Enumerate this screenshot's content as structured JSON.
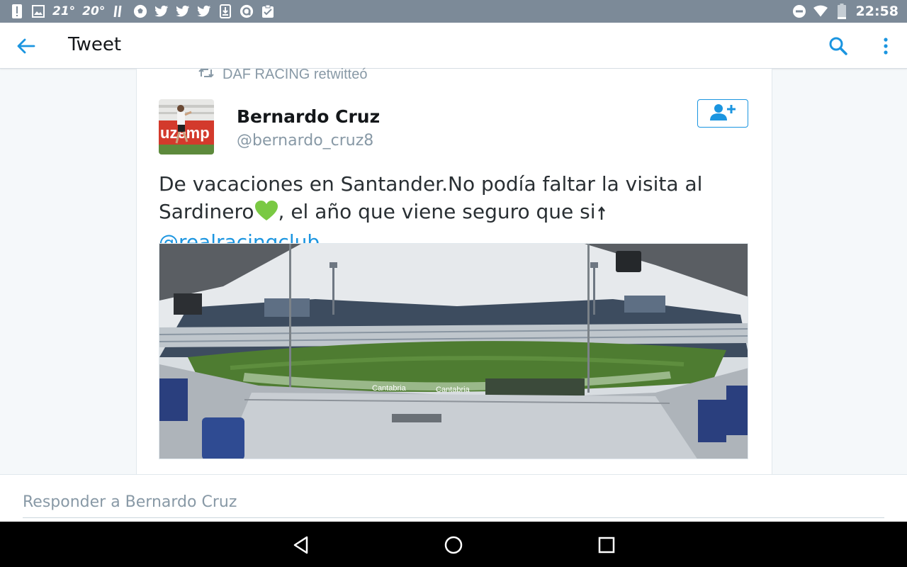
{
  "status_bar": {
    "temp1": "21°",
    "temp2": "20°",
    "time": "22:58",
    "battery_level": 0.15,
    "left_icons": [
      "alert-icon",
      "image-icon",
      "weather-icon",
      "soccer-icon",
      "twitter-icon",
      "twitter-icon",
      "twitter-icon",
      "download-icon",
      "app-icon",
      "clipboard-icon"
    ],
    "right_icons": [
      "do-not-disturb-icon",
      "wifi-icon",
      "battery-icon"
    ]
  },
  "app_bar": {
    "title": "Tweet",
    "icons": [
      "back-arrow-icon",
      "search-icon",
      "more-vert-icon"
    ]
  },
  "tweet": {
    "retweet_label": "DAF RACING retwitteó",
    "author_name": "Bernardo Cruz",
    "author_handle": "@bernardo_cruz8",
    "text_part1": "De vacaciones en Santander.No podía faltar la visita al Sardinero",
    "text_part2": ", el año que viene seguro que si",
    "mention": "@realracingclub",
    "emoji_heart": "green-heart-icon",
    "emoji_arrow": "up-arrow-icon",
    "avatar_text": "uzemp",
    "photo_banner_text": "Cantabria",
    "photo_banner_text2": "Cantabria"
  },
  "reply": {
    "placeholder": "Responder a Bernardo Cruz"
  },
  "colors": {
    "accent": "#1b95e0",
    "status_bar": "#7c8a98",
    "heart": "#7ac943"
  }
}
